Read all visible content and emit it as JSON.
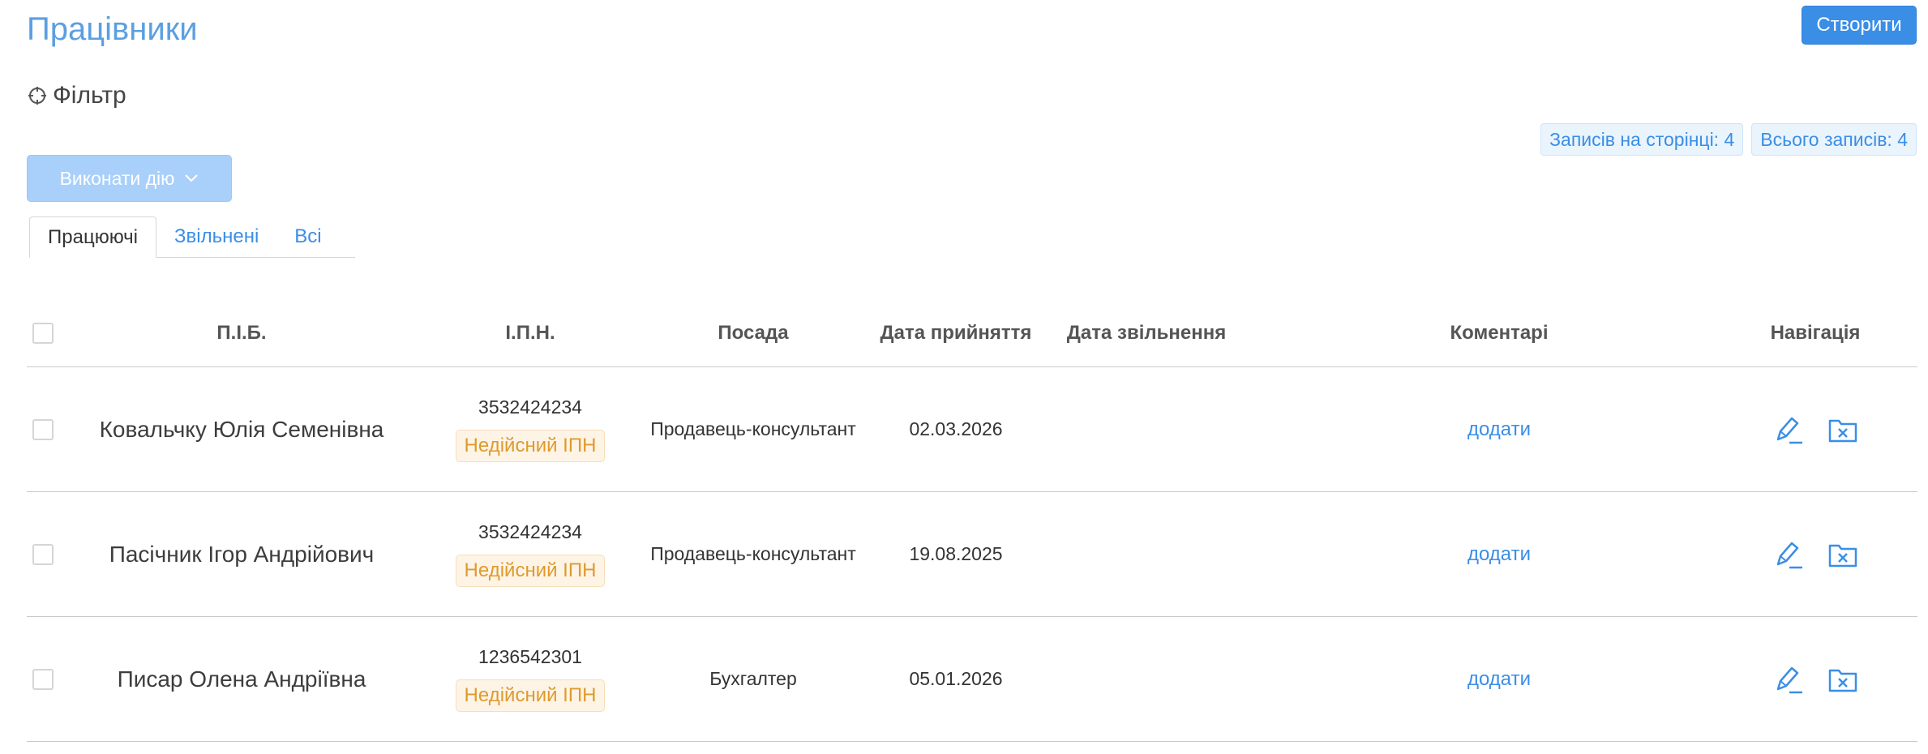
{
  "page_title": "Працівники",
  "create_label": "Створити",
  "filter_label": "Фільтр",
  "counters": {
    "per_page": "Записів на сторінці: 4",
    "total": "Всього записів: 4"
  },
  "action_label": "Виконати дію",
  "tabs": [
    {
      "label": "Працюючі",
      "active": true
    },
    {
      "label": "Звільнені",
      "active": false
    },
    {
      "label": "Всі",
      "active": false
    }
  ],
  "columns": {
    "name": "П.І.Б.",
    "ipn": "І.П.Н.",
    "position": "Посада",
    "hire_date": "Дата прийняття",
    "fire_date": "Дата звільнення",
    "comments": "Коментарі",
    "navigation": "Навігація"
  },
  "rows": [
    {
      "name": "Ковальчку Юлія Семенівна",
      "ipn": "3532424234",
      "ipn_status": "Недійсний ІПН",
      "position": "Продавець-консультант",
      "hire_date": "02.03.2026",
      "fire_date": "",
      "comment_link": "додати"
    },
    {
      "name": "Пасічник Ігор Андрійович",
      "ipn": "3532424234",
      "ipn_status": "Недійсний ІПН",
      "position": "Продавець-консультант",
      "hire_date": "19.08.2025",
      "fire_date": "",
      "comment_link": "додати"
    },
    {
      "name": "Писар Олена Андріївна",
      "ipn": "1236542301",
      "ipn_status": "Недійсний ІПН",
      "position": "Бухгалтер",
      "hire_date": "05.01.2026",
      "fire_date": "",
      "comment_link": "додати"
    }
  ],
  "colors": {
    "accent": "#3a8ee6",
    "title": "#5b9fe0",
    "badge_text": "#e09a2c",
    "badge_bg": "#fdf4e6"
  }
}
